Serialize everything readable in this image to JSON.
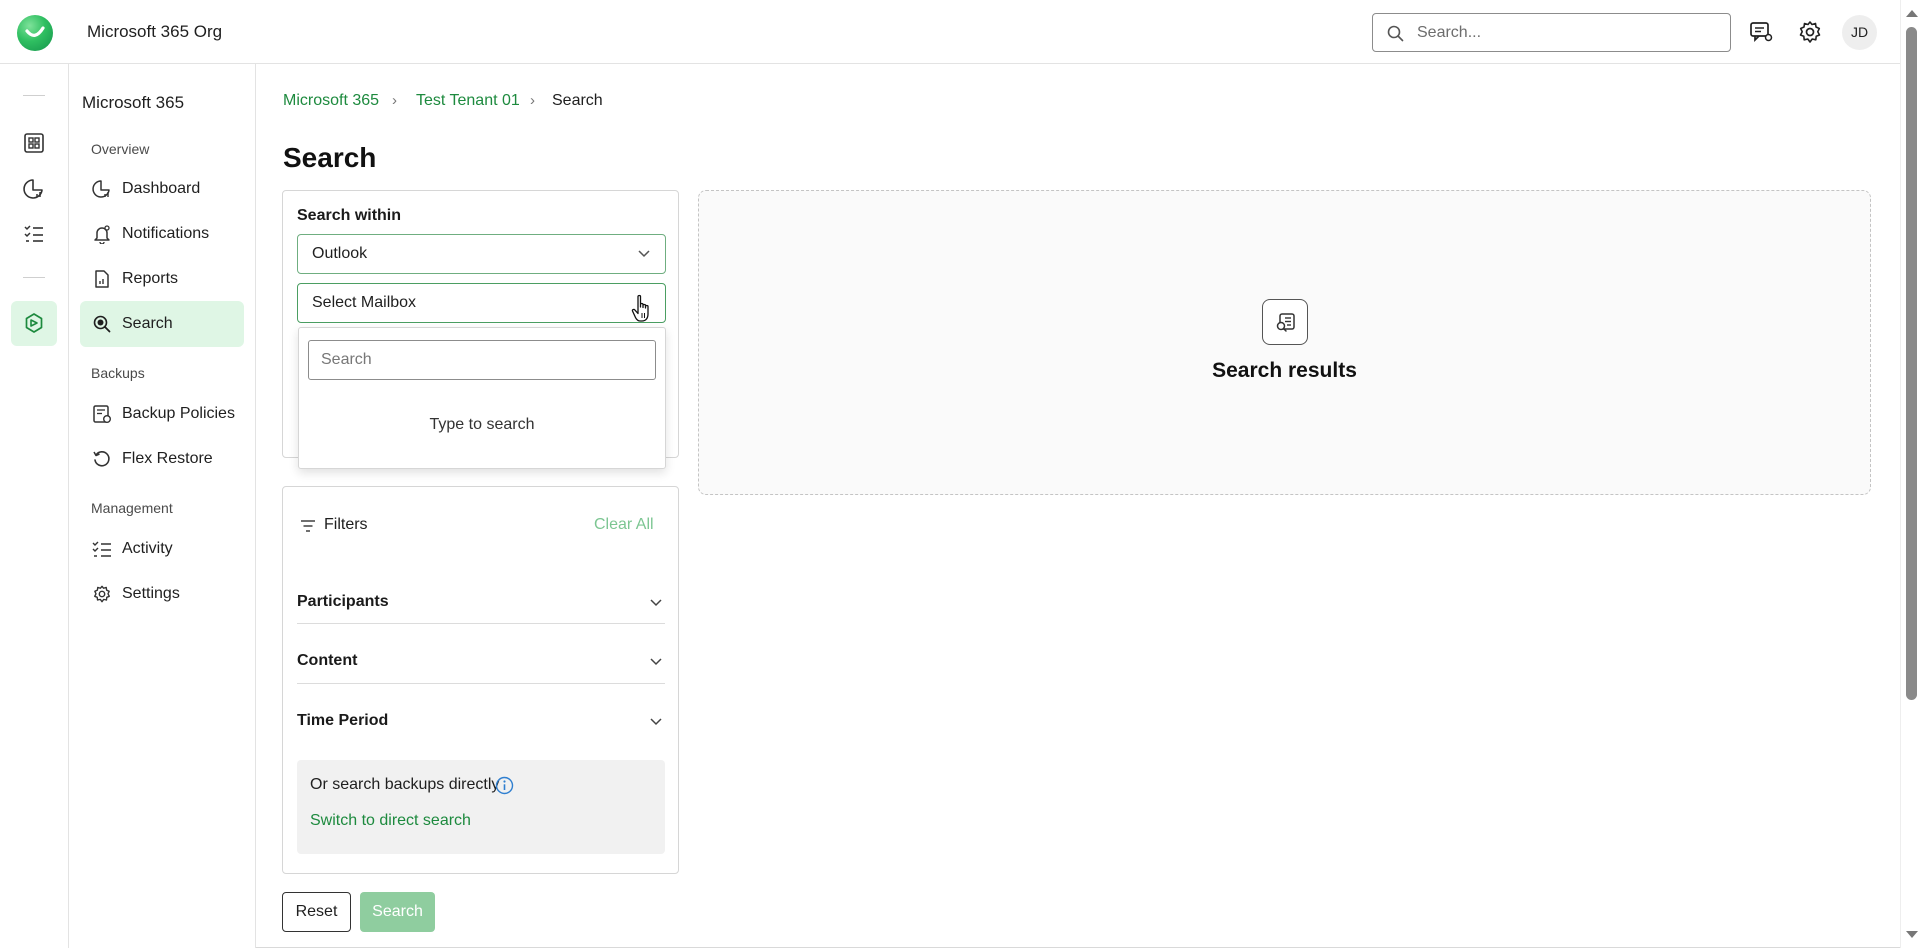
{
  "app": {
    "org_name": "Microsoft 365 Org"
  },
  "header": {
    "search_placeholder": "Search...",
    "avatar_initials": "JD"
  },
  "sidebar": {
    "title": "Microsoft 365",
    "groups": {
      "overview": "Overview",
      "backups": "Backups",
      "management": "Management"
    },
    "items": {
      "dashboard": "Dashboard",
      "notifications": "Notifications",
      "reports": "Reports",
      "search": "Search",
      "backup_policies": "Backup Policies",
      "flex_restore": "Flex Restore",
      "activity": "Activity",
      "settings": "Settings"
    },
    "active_item": "search"
  },
  "breadcrumb": {
    "root": "Microsoft 365",
    "tenant": "Test Tenant 01",
    "current": "Search"
  },
  "page": {
    "title": "Search"
  },
  "search_within": {
    "label": "Search within",
    "service_value": "Outlook",
    "mailbox_value": "Select Mailbox",
    "dropdown_search_placeholder": "Search",
    "dropdown_hint": "Type to search"
  },
  "results": {
    "title": "Search results"
  },
  "filters": {
    "label": "Filters",
    "clear_all": "Clear All",
    "sections": [
      "Participants",
      "Content",
      "Time Period"
    ]
  },
  "direct_search": {
    "text": "Or search backups directly",
    "link": "Switch to direct search"
  },
  "actions": {
    "reset": "Reset",
    "search": "Search"
  },
  "colors": {
    "accent": "#1d8a3e",
    "active_bg": "#dff6e5",
    "search_button": "#8fcd9f"
  }
}
